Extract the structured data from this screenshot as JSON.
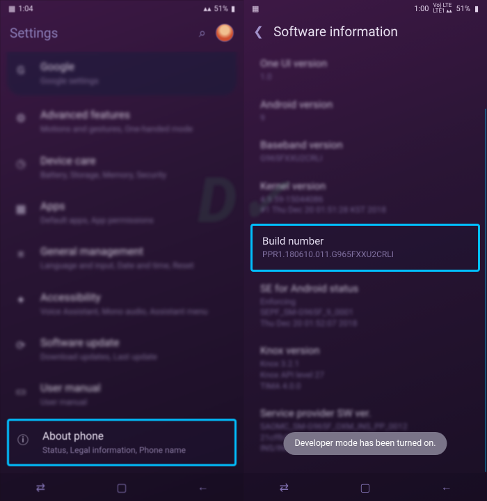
{
  "left": {
    "status": {
      "time": "1:04",
      "right": "51%"
    },
    "header": {
      "title": "Settings"
    },
    "items": [
      {
        "icon": "G",
        "title": "Google",
        "sub": "Google settings",
        "top": true
      },
      {
        "icon": "⚙",
        "title": "Advanced features",
        "sub": "Motions and gestures, One-handed mode"
      },
      {
        "icon": "◷",
        "title": "Device care",
        "sub": "Battery, Storage, Memory, Security"
      },
      {
        "icon": "▦",
        "title": "Apps",
        "sub": "Default apps, App permissions"
      },
      {
        "icon": "≡",
        "title": "General management",
        "sub": "Language and input, Date and time, Reset"
      },
      {
        "icon": "✦",
        "title": "Accessibility",
        "sub": "Voice Assistant, Mono audio, Assistant menu"
      },
      {
        "icon": "⟳",
        "title": "Software update",
        "sub": "Download updates, Last update"
      },
      {
        "icon": "▭",
        "title": "User manual",
        "sub": "User manual"
      },
      {
        "icon": "ⓘ",
        "title": "About phone",
        "sub": "Status, Legal information, Phone name",
        "highlight": true
      }
    ]
  },
  "right": {
    "status": {
      "time": "1:00",
      "right": "51%"
    },
    "header": {
      "title": "Software information"
    },
    "items": [
      {
        "title": "One UI version",
        "val": "1.0"
      },
      {
        "title": "Android version",
        "val": "9"
      },
      {
        "title": "Baseband version",
        "val": "G965FXXU2CRLI"
      },
      {
        "title": "Kernel version",
        "val": "4.9.59-15044086\n#1 Thu Dec 20 01:51:28 KST 2018"
      },
      {
        "title": "Build number",
        "val": "PPR1.180610.011.G965FXXU2CRLI",
        "highlight": true
      },
      {
        "title": "SE for Android status",
        "val": "Enforcing\nSEPF_SM-G965F_9_0001\nThu Dec 20 01:52:07 2018"
      },
      {
        "title": "Knox version",
        "val": "Knox 3.2.1\nKnox API level 27\nTIMA 4.0.0"
      },
      {
        "title": "Service provider SW ver.",
        "val": "SAOMC_SM-G965F_OXM_INS_PP_0012\n21cffb5fc0e047ece\nINS/INS,INS/INS"
      }
    ],
    "toast": "Developer mode has been turned on."
  },
  "nav": {
    "recent": "⇄",
    "home": "▢",
    "back": "←"
  }
}
